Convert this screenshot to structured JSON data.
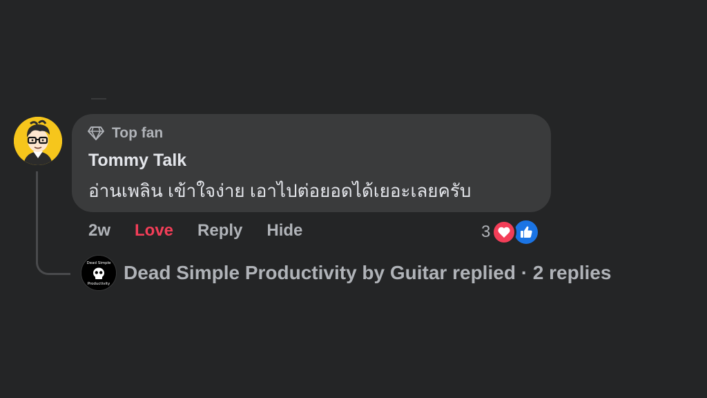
{
  "comment": {
    "badge": {
      "label": "Top fan",
      "icon": "diamond-icon"
    },
    "author": "Tommy Talk",
    "text": "อ่านเพลิน เข้าใจง่าย เอาไปต่อยอดได้เยอะเลยครับ",
    "avatar": {
      "icon": "cartoon-avatar",
      "background": "#f6c61c"
    }
  },
  "actions": {
    "time": "2w",
    "love": "Love",
    "reply": "Reply",
    "hide": "Hide"
  },
  "reactions": {
    "count": "3",
    "types": [
      "heart-icon",
      "like-icon"
    ]
  },
  "replies": {
    "page_avatar_text": "Dead Simple Productivity",
    "summary": "Dead Simple Productivity by Guitar replied · 2 replies"
  },
  "colors": {
    "background": "#242526",
    "bubble": "#3a3b3c",
    "text_primary": "#e4e6eb",
    "text_secondary": "#b0b3b8",
    "love": "#f33e58",
    "like": "#1b74e4"
  }
}
